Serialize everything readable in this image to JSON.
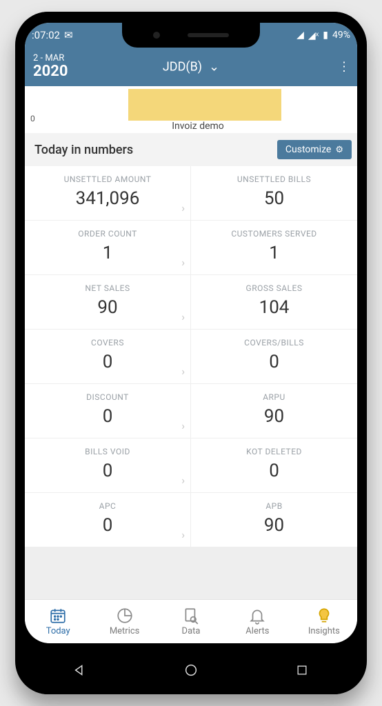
{
  "status": {
    "time": ":07:02",
    "battery": "49%",
    "signal_icons": [
      "signal-icon",
      "signal-x-icon"
    ]
  },
  "header": {
    "date_line1": "2 - MAR",
    "date_line2": "2020",
    "title": "JDD(B)"
  },
  "chart_data": {
    "type": "bar",
    "categories": [
      "Invoiz demo"
    ],
    "values": [
      1
    ],
    "xlabel": "Invoiz demo",
    "ylabel": "",
    "ylim": [
      0,
      1
    ],
    "title": ""
  },
  "section": {
    "title": "Today in numbers",
    "customize_label": "Customize"
  },
  "metrics": [
    {
      "label": "UNSETTLED AMOUNT",
      "value": "341,096"
    },
    {
      "label": "UNSETTLED BILLS",
      "value": "50"
    },
    {
      "label": "ORDER COUNT",
      "value": "1"
    },
    {
      "label": "CUSTOMERS SERVED",
      "value": "1"
    },
    {
      "label": "NET SALES",
      "value": "90"
    },
    {
      "label": "GROSS SALES",
      "value": "104"
    },
    {
      "label": "COVERS",
      "value": "0"
    },
    {
      "label": "COVERS/BILLS",
      "value": "0"
    },
    {
      "label": "DISCOUNT",
      "value": "0"
    },
    {
      "label": "ARPU",
      "value": "90"
    },
    {
      "label": "BILLS VOID",
      "value": "0"
    },
    {
      "label": "KOT DELETED",
      "value": "0"
    },
    {
      "label": "APC",
      "value": "0"
    },
    {
      "label": "APB",
      "value": "90"
    }
  ],
  "tabs": [
    {
      "label": "Today",
      "active": true
    },
    {
      "label": "Metrics",
      "active": false
    },
    {
      "label": "Data",
      "active": false
    },
    {
      "label": "Alerts",
      "active": false
    },
    {
      "label": "Insights",
      "active": false
    }
  ],
  "chart_label": "Invoiz demo",
  "chart_yzero": "0"
}
